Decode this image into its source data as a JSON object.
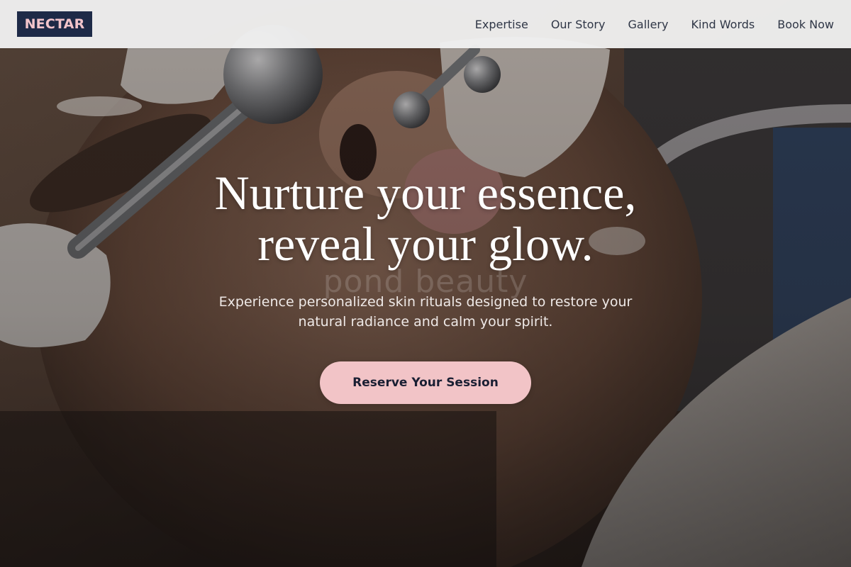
{
  "brand": {
    "logo_text": "NECTAR",
    "logo_bg": "#1e2a47",
    "logo_fg": "#f2c4cb"
  },
  "nav": {
    "items": [
      {
        "label": "Expertise"
      },
      {
        "label": "Our Story"
      },
      {
        "label": "Gallery"
      },
      {
        "label": "Kind Words"
      },
      {
        "label": "Book Now"
      }
    ]
  },
  "hero": {
    "headline_line1": "Nurture your essence,",
    "headline_line2": "reveal your glow.",
    "subtitle": "Experience personalized skin rituals designed to restore your natural radiance and calm your spirit.",
    "cta_label": "Reserve Your Session",
    "cta_color": "#f2c4c7",
    "watermark": "pond beauty",
    "background_image": "facial treatment photo"
  }
}
